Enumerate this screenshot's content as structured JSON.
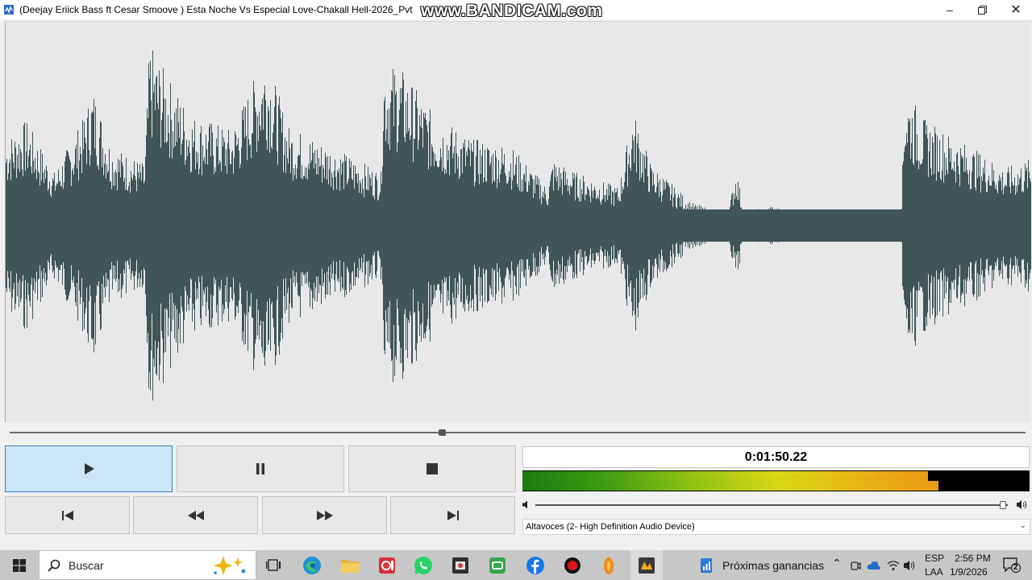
{
  "window": {
    "title": "(Deejay Eriick Bass ft Cesar Smoove ) Esta Noche Vs Especial Love-Chakall Hell-2026_Pvt",
    "watermark": "www.BANDICAM.com"
  },
  "player": {
    "waveform_color": "#3f5557",
    "seek_position": 0.425,
    "time_display": "0:01:50.22",
    "level_meter": {
      "top": 0.8,
      "bottom": 0.82
    },
    "volume": 0.99,
    "output_device": "Altavoces (2- High Definition Audio Device)",
    "buttons": {
      "play": "play-icon",
      "pause": "pause-icon",
      "stop": "stop-icon",
      "previous": "skip-previous-icon",
      "rewind": "rewind-icon",
      "forward": "fast-forward-icon",
      "next": "skip-next-icon"
    }
  },
  "taskbar": {
    "search_placeholder": "Buscar",
    "widget_label": "Próximas ganancias",
    "language": "ESP",
    "layout": "LAA",
    "time": "2:56 PM",
    "date": "1/9/2026",
    "notification_count": "2"
  }
}
